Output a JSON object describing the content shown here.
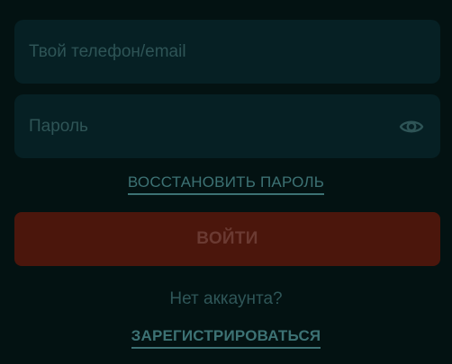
{
  "form": {
    "login_placeholder": "Твой телефон/email",
    "login_value": "",
    "password_placeholder": "Пароль",
    "password_value": "",
    "restore_password_label": "ВОССТАНОВИТЬ ПАРОЛЬ",
    "submit_label": "ВОЙТИ",
    "no_account_text": "Нет аккаунта?",
    "register_label": "ЗАРЕГИСТРИРОВАТЬСЯ"
  },
  "icons": {
    "password_toggle": "eye-icon"
  },
  "colors": {
    "background": "#031212",
    "field_background": "#062024",
    "submit_background": "#4b160c",
    "link": "#3d7274"
  }
}
